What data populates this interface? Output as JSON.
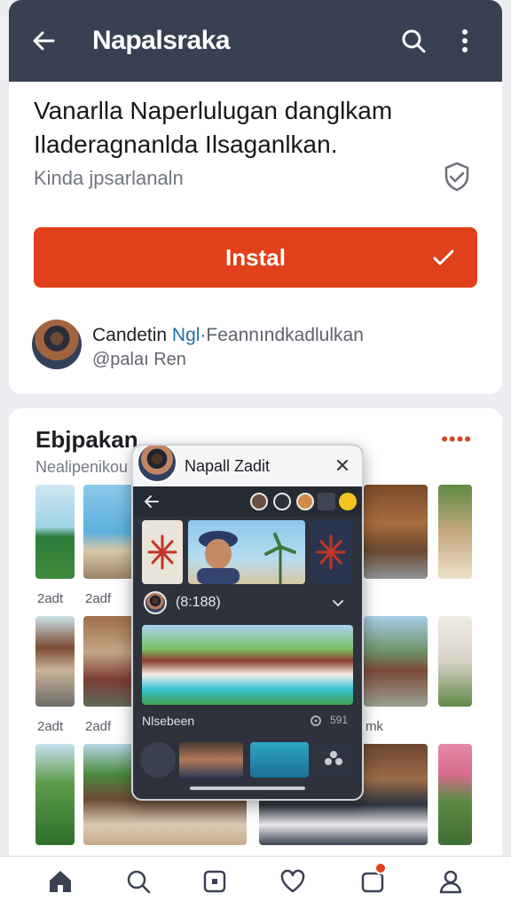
{
  "header": {
    "title": "Napalsraka",
    "icons": [
      "back-arrow-icon",
      "search-icon",
      "more-vertical-icon"
    ]
  },
  "app": {
    "headline_line1": "Vanarlla Naperlulugan danglkam",
    "headline_line2": "Iladeragnanlda Ilsaganlkan.",
    "subtitle": "Kinda jpsarlanaln",
    "install_label": "Instal"
  },
  "developer": {
    "name_a": "Candetin ",
    "name_b": "Ngl·",
    "name_c": "Feannındkadlulkan",
    "meta": "@palaı Ren"
  },
  "section": {
    "title": "Ebjpakan",
    "subtitle": "Nealipenikou",
    "more": "••••",
    "labels": [
      "2adt",
      "2adf",
      "2adt",
      "2adf",
      "mk"
    ]
  },
  "popup": {
    "title": "Napall Zadit",
    "row_text": "(8:188)",
    "footer_text": "Nlsebeen",
    "footer_count": "591"
  },
  "nav": {
    "items": [
      "home-icon",
      "search-icon",
      "library-icon",
      "heart-icon",
      "notifications-icon",
      "profile-icon"
    ]
  },
  "colors": {
    "header_bg": "#374152",
    "accent": "#e0401a",
    "link": "#1e6fa3"
  }
}
